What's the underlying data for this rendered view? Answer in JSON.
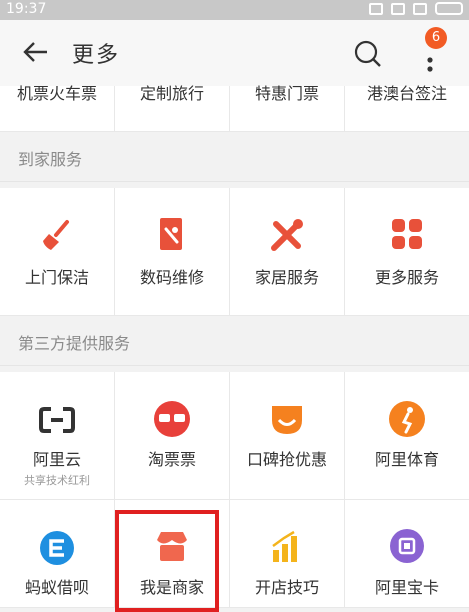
{
  "status_bar": {
    "time": "19:37"
  },
  "header": {
    "title": "更多",
    "badge_count": "6"
  },
  "top_row": [
    "机票火车票",
    "定制旅行",
    "特惠门票",
    "港澳台签注"
  ],
  "sections": [
    {
      "title": "到家服务",
      "items": [
        {
          "label": "上门保洁",
          "icon": "broom-icon"
        },
        {
          "label": "数码维修",
          "icon": "phone-repair-icon"
        },
        {
          "label": "家居服务",
          "icon": "tools-icon"
        },
        {
          "label": "更多服务",
          "icon": "grid-icon"
        }
      ]
    },
    {
      "title": "第三方提供服务",
      "items": [
        {
          "label": "阿里云",
          "sublabel": "共享技术红利",
          "icon": "aliyun-icon"
        },
        {
          "label": "淘票票",
          "icon": "taopiaopiao-icon"
        },
        {
          "label": "口碑抢优惠",
          "icon": "koubei-icon"
        },
        {
          "label": "阿里体育",
          "icon": "ali-sports-icon"
        },
        {
          "label": "蚂蚁借呗",
          "icon": "jiebei-icon"
        },
        {
          "label": "我是商家",
          "icon": "store-icon"
        },
        {
          "label": "开店技巧",
          "icon": "chart-icon"
        },
        {
          "label": "阿里宝卡",
          "icon": "baoka-icon"
        }
      ]
    }
  ],
  "colors": {
    "accent": "#f25b24",
    "highlight": "#e02020"
  }
}
